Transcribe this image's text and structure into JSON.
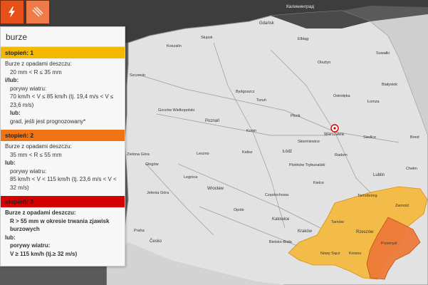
{
  "toolbar": {
    "storm_icon": "lightning-icon",
    "layer_icon": "rain-icon"
  },
  "panel": {
    "title": "burze",
    "levels": [
      {
        "heading": "stopień: 1",
        "color": "#f5b800",
        "lines": [
          "Burze z opadami deszczu:",
          "20 mm < R ≤ 35 mm",
          "i/lub:",
          "porywy wiatru:",
          "70 km/h < V ≤ 85 km/h (tj. 19,4 m/s < V ≤",
          "23,6 m/s)",
          "lub:",
          "grad, jeśli jest prognozowany*"
        ]
      },
      {
        "heading": "stopień: 2",
        "color": "#f07414",
        "lines": [
          "Burze z opadami deszczu:",
          "35 mm < R ≤ 55 mm",
          "lub:",
          "porywy wiatru:",
          "85 km/h < V < 115 km/h (tj. 23,6 m/s < V <",
          "32 m/s)"
        ]
      },
      {
        "heading": "stopień: 3",
        "color": "#d50000",
        "lines": [
          "Burze z opadami deszczu:",
          "R > 55 mm w okresie trwania zjawisk",
          "burzowych",
          "lub:",
          "porywy wiatru:",
          "V ≥ 115 km/h (tj.≥ 32 m/s)"
        ]
      }
    ]
  },
  "map": {
    "labels": {
      "kaliningrad": "Калининград",
      "gdansk": "Gdańsk",
      "szczecin": "Szczecin",
      "bydgoszcz": "Bydgoszcz",
      "olsztyn": "Olsztyn",
      "bialystok": "Białystok",
      "poznan": "Poznań",
      "warszawa": "Warszawa",
      "lodz": "Łódź",
      "wroclaw": "Wrocław",
      "kielce": "Kielce",
      "lublin": "Lublin",
      "krakow": "Kraków",
      "katowice": "Katowice",
      "rzeszow": "Rzeszów",
      "tarnow": "Tarnów",
      "zamosc": "Zamość",
      "praha": "Praha",
      "cesko": "Česko",
      "gorzow": "Gorzów Wielkopolski",
      "zielona": "Zielona Góra",
      "opole": "Opole",
      "czestochowa": "Częstochowa",
      "radom": "Radom",
      "plock": "Płock",
      "konin": "Konin",
      "torun": "Toruń",
      "koszalin": "Koszalin",
      "slupsk": "Słupsk",
      "elblag": "Elbląg",
      "suwalki": "Suwałki",
      "legnica": "Legnica",
      "jelenia": "Jelenia Góra",
      "kalisz": "Kalisz",
      "leszno": "Leszno",
      "siedlce": "Siedlce",
      "chelm": "Chełm",
      "przemysl": "Przemyśl",
      "krosno": "Krosno",
      "nowy_sacz": "Nowy Sącz",
      "tarnobrzeg": "Tarnobrzeg",
      "piotrkow": "Piotrków Trybunalski",
      "skierniewice": "Skierniewice",
      "ostroleka": "Ostrołęka",
      "lomza": "Łomża",
      "glogow": "Głogów",
      "bielsko": "Bielsko-Biała",
      "brest": "Brest"
    }
  }
}
